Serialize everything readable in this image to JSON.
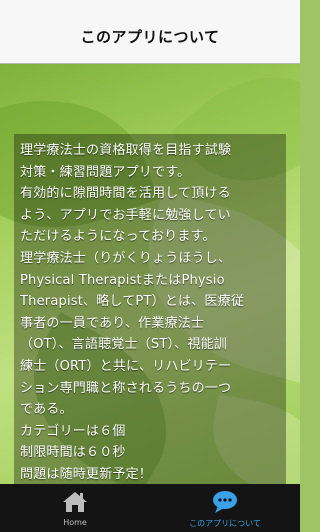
{
  "navbar": {
    "title": "このアプリについて"
  },
  "content": {
    "lines": [
      "理学療法士の資格取得を目指す試験",
      "対策・練習問題アプリです。",
      "有効的に隙間時間を活用して頂ける",
      "よう、アプリでお手軽に勉強してい",
      "ただけるようになっております。",
      "理学療法士（りがくりょうほうし、",
      "Physical TherapistまたはPhysio",
      "Therapist、略してPT）とは、医療従",
      "事者の一員であり、作業療法士",
      "（OT）、言語聴覚士（ST）、視能訓",
      "練士（ORT）と共に、リハビリテー",
      "ション専門職と称されるうちの一つ",
      "である。",
      "カテゴリーは６個",
      "制限時間は６０秒",
      "問題は随時更新予定！"
    ]
  },
  "tabbar": {
    "tabs": [
      {
        "label": "Home",
        "icon": "house-icon",
        "selected": false
      },
      {
        "label": "このアプリについて",
        "icon": "speech-bubble-icon",
        "selected": true
      }
    ]
  },
  "colors": {
    "tab_active": "#3aa0e8",
    "tab_inactive": "#bdbdbd",
    "tabbar_bg": "#141414",
    "navbar_bg": "#f7f7f7"
  }
}
